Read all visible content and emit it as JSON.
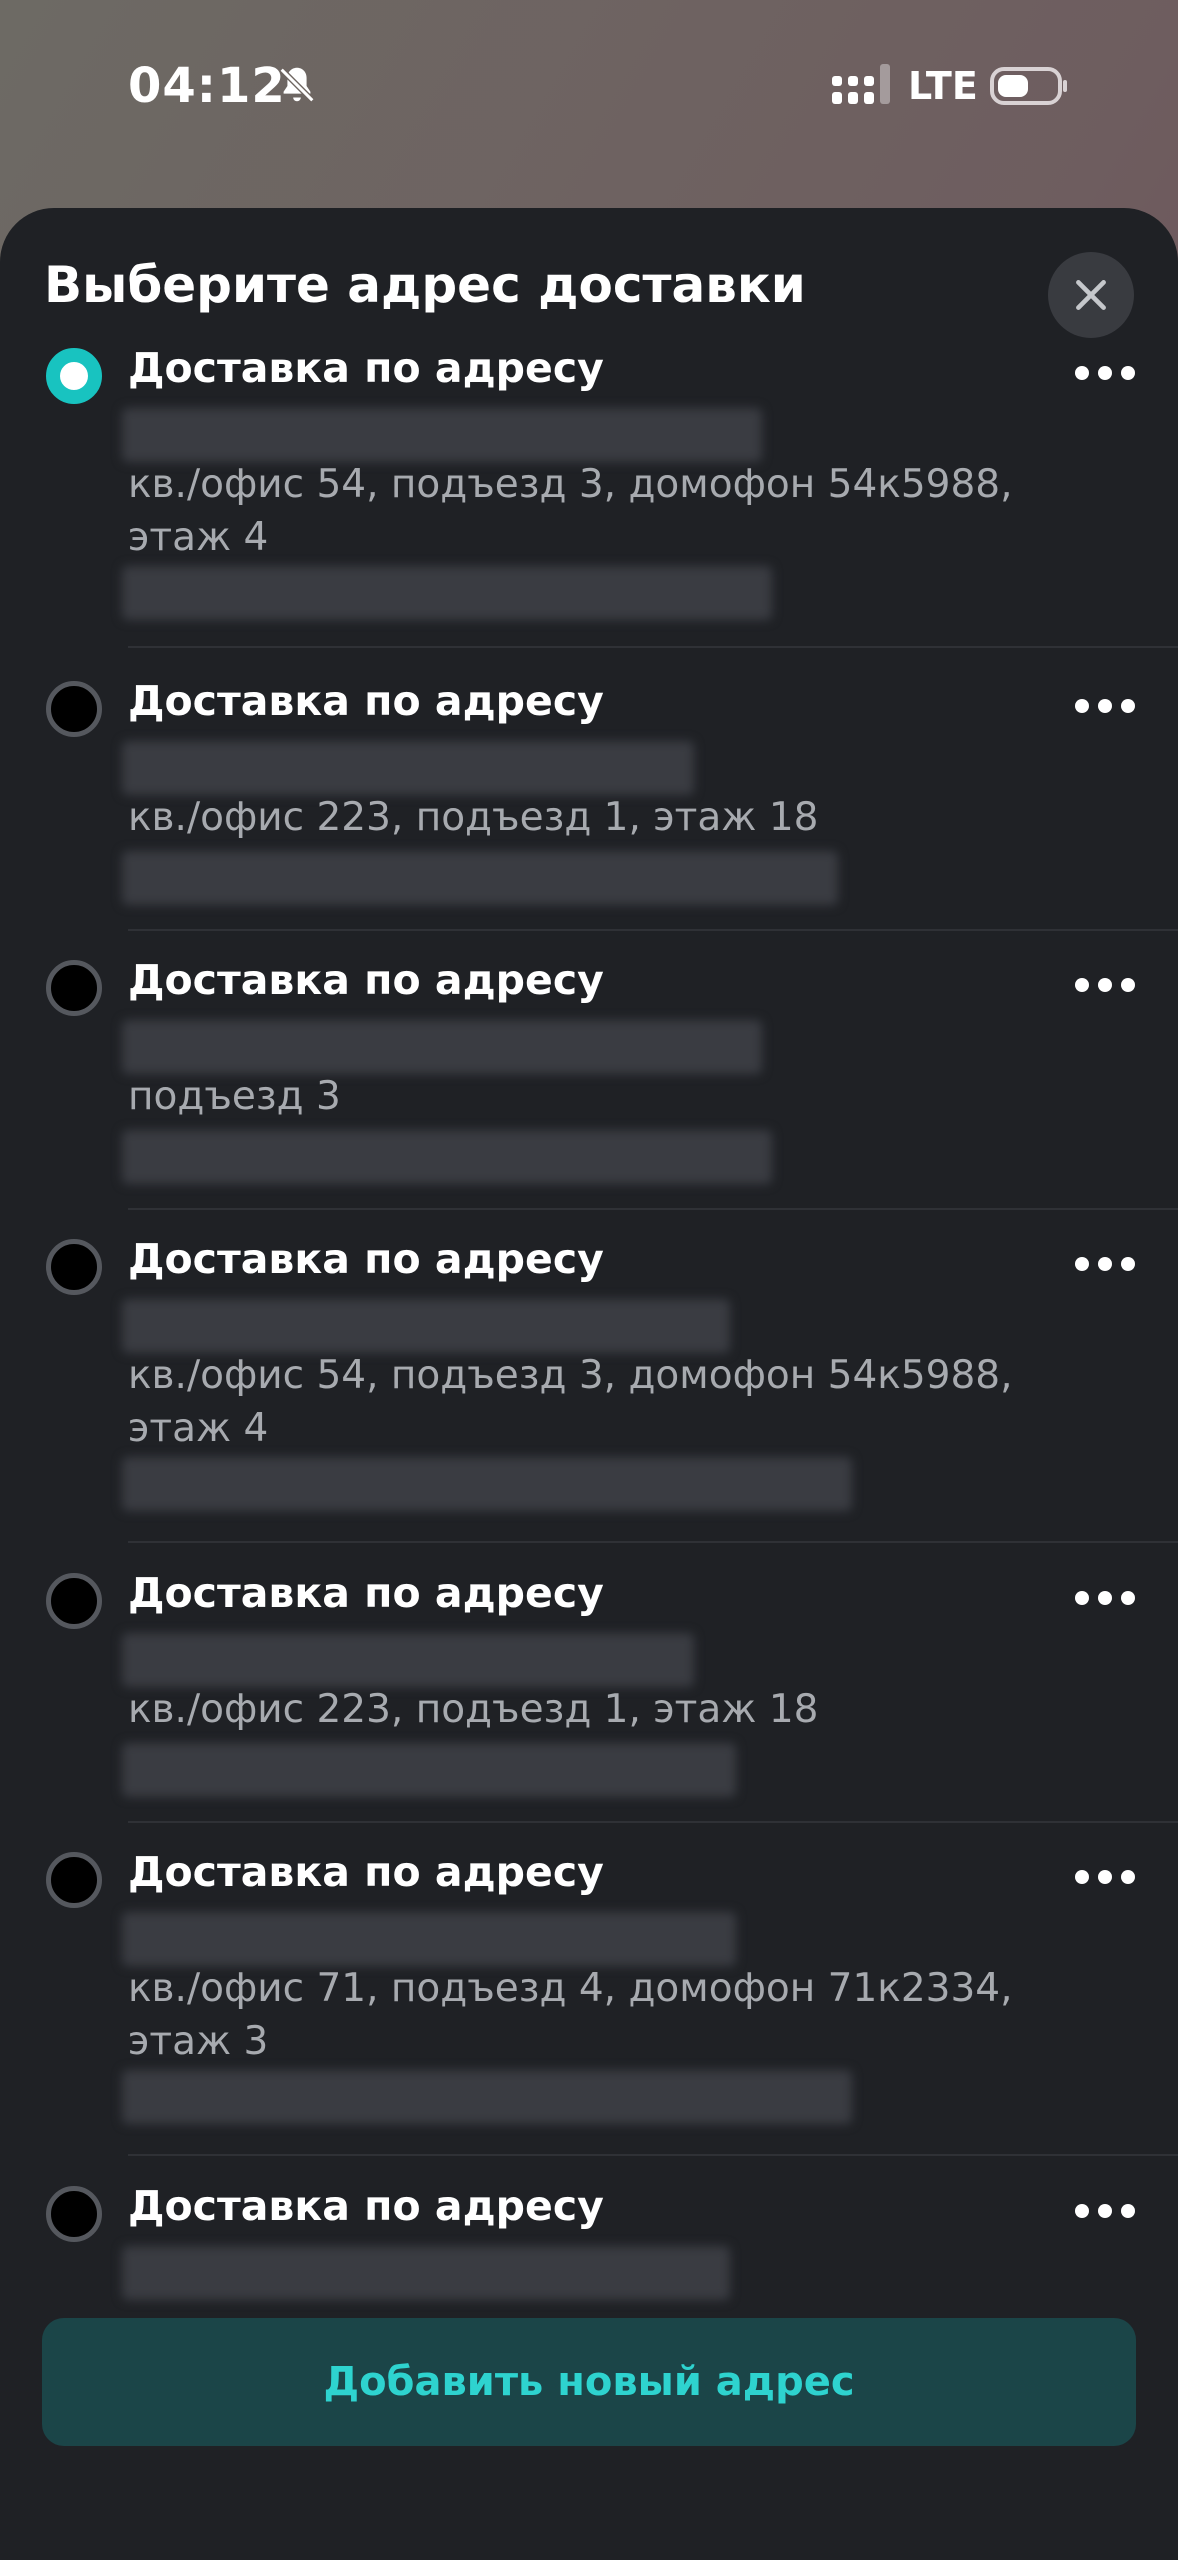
{
  "status_bar": {
    "time": "04:12",
    "network": "LTE",
    "icons": [
      "bell-muted-icon",
      "signal-icon",
      "battery-icon"
    ]
  },
  "sheet": {
    "title": "Выберите адрес доставки",
    "close_icon": "close-icon"
  },
  "addresses": [
    {
      "title": "Доставка по адресу",
      "selected": true,
      "details": "кв./офис 54, подъезд 3, домофон 54к5988, этаж 4"
    },
    {
      "title": "Доставка по адресу",
      "selected": false,
      "details": "кв./офис 223, подъезд 1, этаж 18"
    },
    {
      "title": "Доставка по адресу",
      "selected": false,
      "details": "подъезд 3"
    },
    {
      "title": "Доставка по адресу",
      "selected": false,
      "details": "кв./офис 54, подъезд 3, домофон 54к5988, этаж 4"
    },
    {
      "title": "Доставка по адресу",
      "selected": false,
      "details": "кв./офис 223, подъезд 1, этаж 18"
    },
    {
      "title": "Доставка по адресу",
      "selected": false,
      "details": "кв./офис 71, подъезд 4, домофон 71к2334, этаж 3"
    },
    {
      "title": "Доставка по адресу",
      "selected": false,
      "details": ""
    }
  ],
  "add_button": {
    "label": "Добавить новый адрес"
  },
  "colors": {
    "accent": "#18c3c0",
    "sheet": "#1f2125",
    "button_bg": "#1b4548",
    "button_text": "#2ed3cf"
  }
}
